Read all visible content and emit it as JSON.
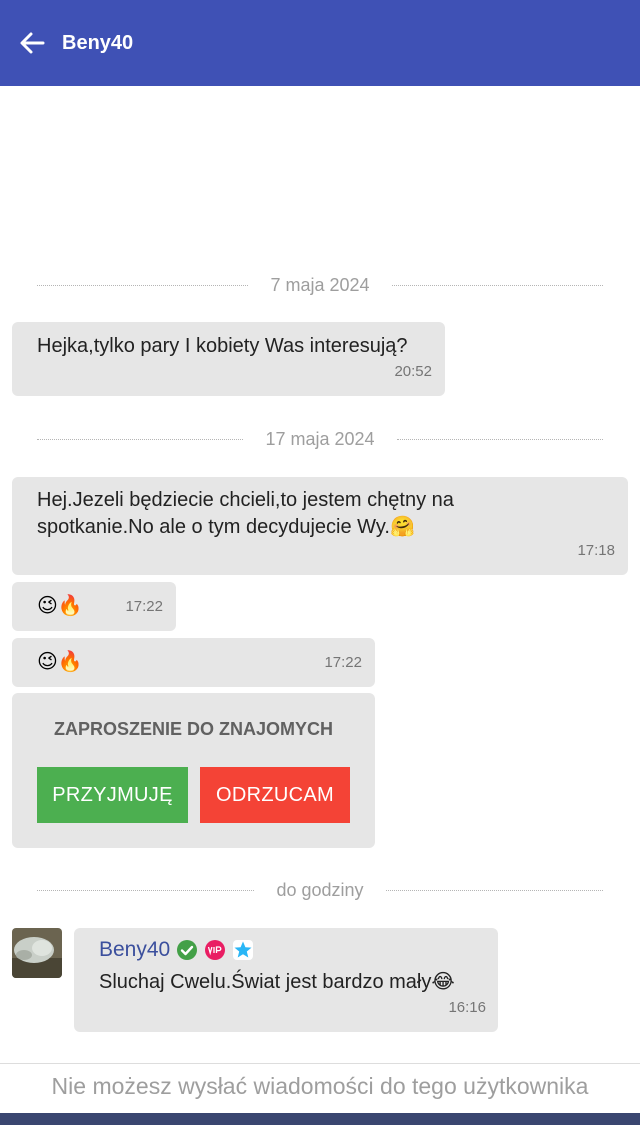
{
  "header": {
    "title": "Beny40",
    "back_icon": "arrow-back-icon"
  },
  "separators": [
    "7 maja 2024",
    "17 maja 2024",
    "do godziny"
  ],
  "messages": [
    {
      "text": "Hejka,tylko pary I kobiety Was interesują?",
      "time": "20:52"
    },
    {
      "line1": "Hej.Jezeli będziecie chcieli,to jestem chętny na",
      "line2": "spotkanie.No ale o tym decydujecie Wy.🤗",
      "time": "17:18"
    },
    {
      "text": "😉🔥",
      "time": "17:22"
    },
    {
      "text": "😉🔥",
      "time": "17:22"
    }
  ],
  "friend_request": {
    "title": "ZAPROSZENIE DO ZNAJOMYCH",
    "accept": "PRZYJMUJĘ",
    "reject": "ODRZUCAM"
  },
  "incoming": {
    "sender": "Beny40",
    "badges": [
      "verified-check-icon",
      "vip-icon",
      "star-icon"
    ],
    "text": "Sluchaj Cwelu.Świat jest bardzo mały😂",
    "time": "16:16"
  },
  "footer": {
    "notice": "Nie możesz wysłać wiadomości do tego użytkownika"
  },
  "colors": {
    "appbar": "#3f51b5",
    "bubble": "#e6e6e6",
    "accept": "#4caf50",
    "reject": "#f44336",
    "sender": "#3b4f9d"
  }
}
